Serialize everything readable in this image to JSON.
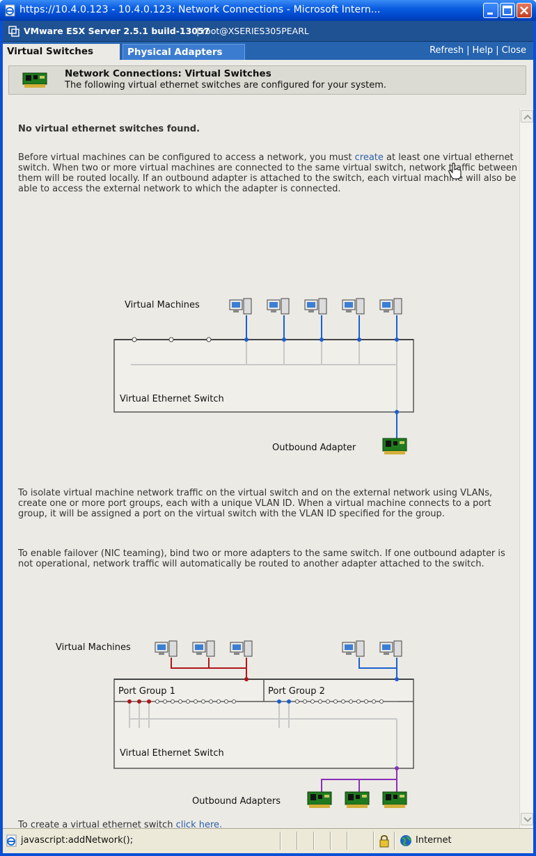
{
  "window": {
    "title": "https://10.4.0.123 - 10.4.0.123: Network Connections - Microsoft Intern..."
  },
  "app": {
    "product": "VMware ESX Server 2.5.1 build-13057",
    "user": "| root@XSERIES305PEARL"
  },
  "tabs": {
    "virtual_switches": "Virtual Switches",
    "physical_adapters": "Physical Adapters"
  },
  "toplinks": {
    "refresh": "Refresh",
    "help": "Help",
    "close": "Close",
    "sep": "|"
  },
  "header": {
    "title": "Network Connections: Virtual Switches",
    "subtitle": "The following virtual ethernet switches are configured for your system."
  },
  "content": {
    "none_found": "No virtual ethernet switches found.",
    "intro_before": "Before virtual machines can be configured to access a network, you must ",
    "intro_link": "create",
    "intro_after": " at least one virtual ethernet switch. When two or more virtual machines are connected to the same virtual switch, network traffic between them will be routed locally. If an outbound adapter is attached to the switch, each virtual machine will also be able to access the external network to which the adapter is connected.",
    "vlan_text": "To isolate virtual machine network traffic on the virtual switch and on the external network using VLANs, create one or more port groups, each with a unique VLAN ID. When a virtual machine connects to a port group, it will be assigned a port on the virtual switch with the VLAN ID specified for the group.",
    "failover_text": "To enable failover (NIC teaming), bind two or more adapters to the same switch. If one outbound adapter is not operational, network traffic will automatically be routed to another adapter attached to the switch.",
    "create_before": "To create a virtual ethernet switch ",
    "create_link": "click here."
  },
  "diagram1": {
    "virtual_machines": "Virtual Machines",
    "switch": "Virtual Ethernet Switch",
    "outbound": "Outbound Adapter"
  },
  "diagram2": {
    "virtual_machines": "Virtual Machines",
    "port_group_1": "Port Group 1",
    "port_group_2": "Port Group 2",
    "switch": "Virtual Ethernet Switch",
    "outbound": "Outbound Adapters"
  },
  "status": {
    "text": "javascript:addNetwork();",
    "zone": "Internet"
  },
  "colors": {
    "blue_line": "#1b5fd0",
    "red_line": "#b0151a",
    "purple_line": "#8a2fb8",
    "link": "#2c5ea8"
  }
}
